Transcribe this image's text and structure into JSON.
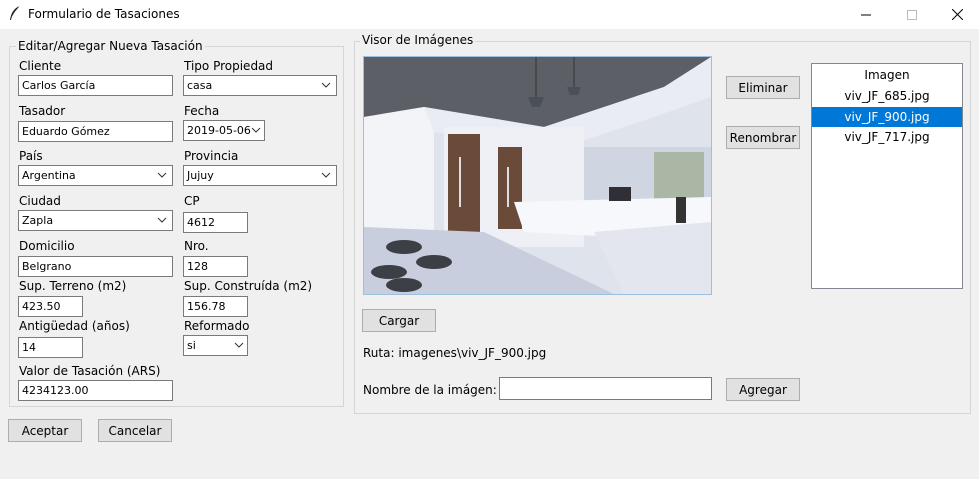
{
  "window": {
    "title": "Formulario de Tasaciones"
  },
  "form": {
    "legend": "Editar/Agregar Nueva Tasación",
    "cliente": {
      "label": "Cliente",
      "value": "Carlos García"
    },
    "tipo": {
      "label": "Tipo Propiedad",
      "value": "casa"
    },
    "tasador": {
      "label": "Tasador",
      "value": "Eduardo Gómez"
    },
    "fecha": {
      "label": "Fecha",
      "value": "2019-05-06"
    },
    "pais": {
      "label": "País",
      "value": "Argentina"
    },
    "provincia": {
      "label": "Provincia",
      "value": "Jujuy"
    },
    "ciudad": {
      "label": "Ciudad",
      "value": "Zapla"
    },
    "cp": {
      "label": "CP",
      "value": "4612"
    },
    "domicilio": {
      "label": "Domicilio",
      "value": "Belgrano"
    },
    "nro": {
      "label": "Nro.",
      "value": "128"
    },
    "sup_terreno": {
      "label": "Sup. Terreno (m2)",
      "value": "423.50"
    },
    "sup_construida": {
      "label": "Sup. Construída (m2)",
      "value": "156.78"
    },
    "antiguedad": {
      "label": "Antigüedad (años)",
      "value": "14"
    },
    "reformado": {
      "label": "Reformado",
      "value": "si"
    },
    "valor": {
      "label": "Valor de Tasación (ARS)",
      "value": "4234123.00"
    }
  },
  "buttons": {
    "aceptar": "Aceptar",
    "cancelar": "Cancelar",
    "eliminar": "Eliminar",
    "renombrar": "Renombrar",
    "cargar": "Cargar",
    "agregar": "Agregar"
  },
  "viewer": {
    "legend": "Visor de Imágenes",
    "ruta": "Ruta: imagenes\\viv_JF_900.jpg",
    "nombre_label": "Nombre de la imágen:",
    "nombre_value": "",
    "list_header": "Imagen",
    "images": [
      "viv_JF_685.jpg",
      "viv_JF_900.jpg",
      "viv_JF_717.jpg"
    ],
    "selected_index": 1
  },
  "colors": {
    "selection": "#0078d7"
  }
}
